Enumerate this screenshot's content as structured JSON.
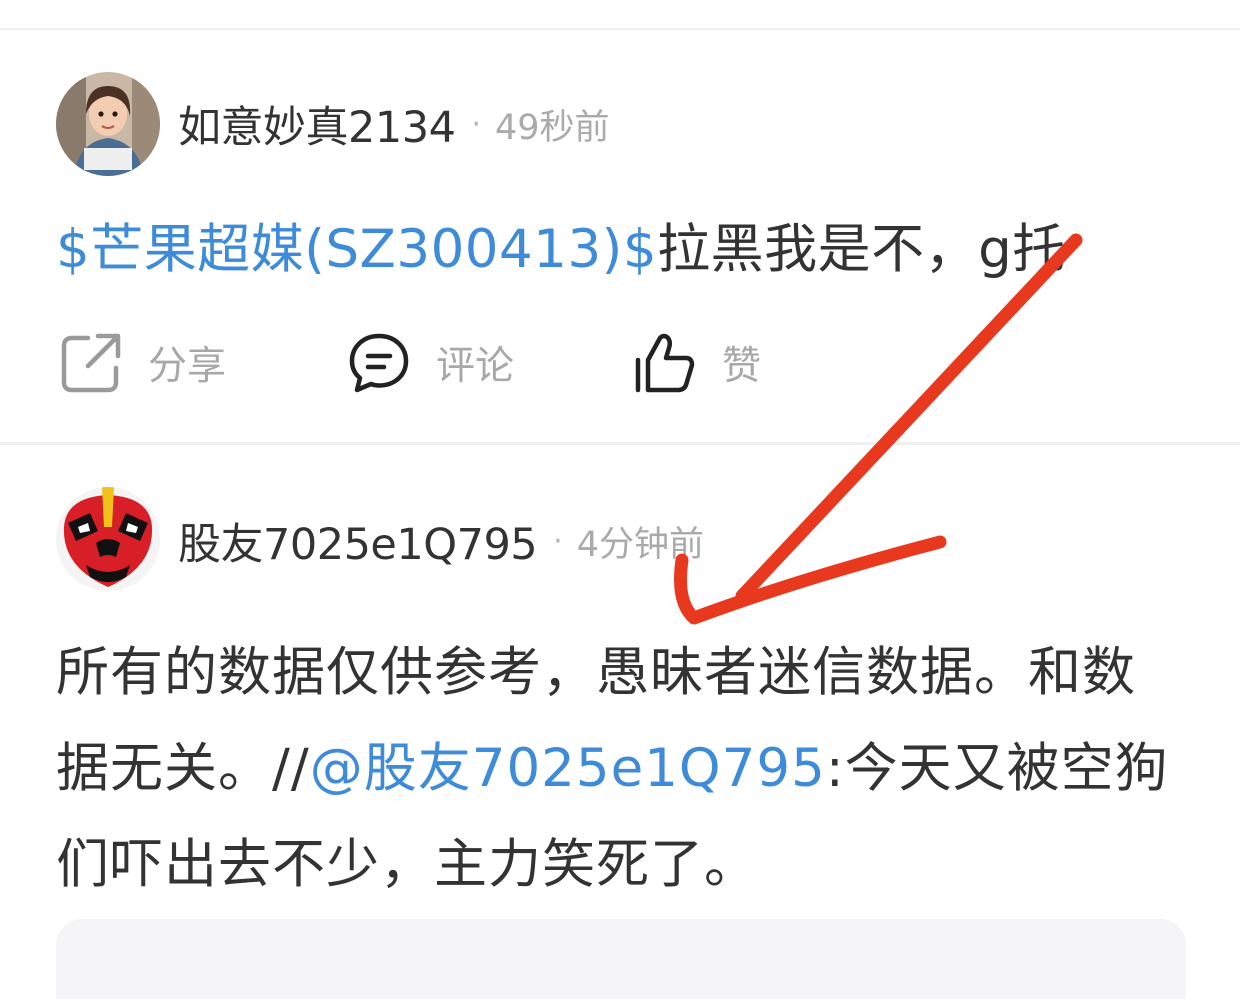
{
  "posts": [
    {
      "username": "如意妙真2134",
      "separator": "·",
      "time": "49秒前",
      "stock_tag": "$芒果超媒(SZ300413)$",
      "text": "拉黑我是不，g托",
      "actions": {
        "share_label": "分享",
        "comment_label": "评论",
        "like_label": "赞"
      }
    },
    {
      "username": "股友7025e1Q795",
      "separator": "·",
      "time": "4分钟前",
      "text_before": "所有的数据仅供参考，愚昧者迷信数据。和数据无关。//",
      "mention": "@股友7025e1Q795",
      "text_after": ":今天又被空狗们吓出去不少，主力笑死了。"
    }
  ],
  "colors": {
    "link": "#3d8bd9",
    "annotation_arrow": "#e8391f",
    "divider": "#efefef",
    "muted_text": "#aaaaaa"
  },
  "icons": {
    "share": "share-icon",
    "comment": "comment-icon",
    "like": "thumbs-up-icon"
  }
}
